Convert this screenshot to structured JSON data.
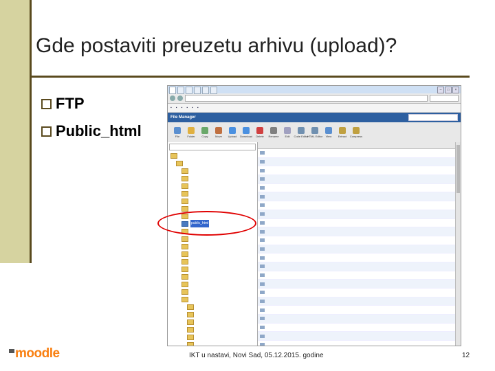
{
  "slide": {
    "title": "Gde postaviti preuzetu arhivu (upload)?",
    "bullets": [
      "FTP",
      "Public_html"
    ],
    "footer": "IKT u nastavi, Novi Sad, 05.12.2015. godine",
    "page_number": "12",
    "logo_text": "moodle"
  },
  "browser": {
    "tabs": [
      "",
      "",
      "",
      "",
      "",
      "",
      ""
    ],
    "url": "",
    "bookmarks": [
      "",
      "",
      "",
      "",
      "",
      "",
      ""
    ],
    "file_manager": {
      "title": "File Manager",
      "toolbar": [
        "File",
        "Folder",
        "Copy",
        "Move",
        "Upload",
        "Download",
        "Delete",
        "Rename",
        "Edit",
        "Code Editor",
        "HTML Editor",
        "View",
        "Extract",
        "Compress"
      ],
      "tree": [
        {
          "label": "",
          "depth": 0
        },
        {
          "label": "",
          "depth": 1
        },
        {
          "label": "",
          "depth": 2
        },
        {
          "label": "",
          "depth": 2
        },
        {
          "label": "",
          "depth": 2
        },
        {
          "label": "",
          "depth": 2
        },
        {
          "label": "",
          "depth": 2
        },
        {
          "label": "",
          "depth": 2
        },
        {
          "label": "",
          "depth": 2
        },
        {
          "label": "public_html",
          "depth": 2,
          "selected": true
        },
        {
          "label": "",
          "depth": 2
        },
        {
          "label": "",
          "depth": 2
        },
        {
          "label": "",
          "depth": 2
        },
        {
          "label": "",
          "depth": 2
        },
        {
          "label": "",
          "depth": 2
        },
        {
          "label": "",
          "depth": 2
        },
        {
          "label": "",
          "depth": 2
        },
        {
          "label": "",
          "depth": 2
        },
        {
          "label": "",
          "depth": 2
        },
        {
          "label": "",
          "depth": 2
        },
        {
          "label": "",
          "depth": 3
        },
        {
          "label": "",
          "depth": 3
        },
        {
          "label": "",
          "depth": 3
        },
        {
          "label": "",
          "depth": 3
        },
        {
          "label": "",
          "depth": 3
        },
        {
          "label": "",
          "depth": 3
        }
      ],
      "list_rows": 23
    }
  },
  "colors": {
    "accent_bar": "#d6d3a0",
    "rule": "#5a4a1e",
    "highlight_ellipse": "#e00000",
    "logo": "#f98012"
  }
}
